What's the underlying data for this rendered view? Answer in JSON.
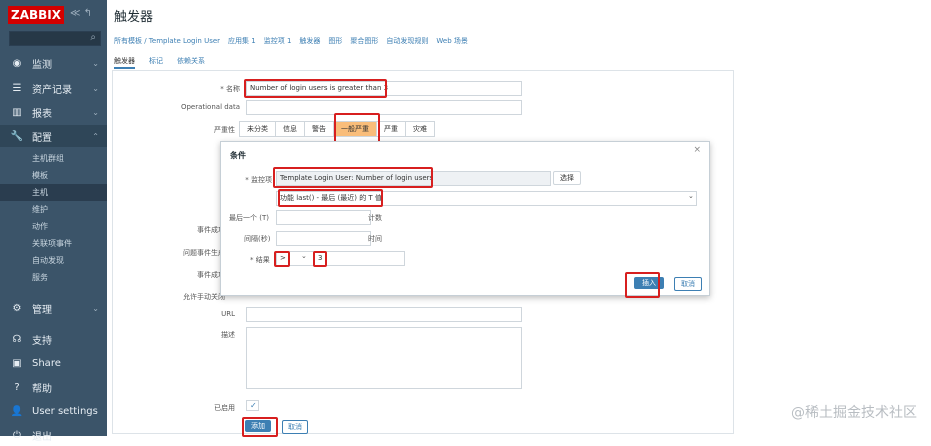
{
  "sidebar": {
    "logo": "ZABBIX",
    "top_icons": "≪ ↰",
    "menu": [
      {
        "icon": "eye-icon",
        "label": "监测"
      },
      {
        "icon": "list-icon",
        "label": "资产记录"
      },
      {
        "icon": "chart-icon",
        "label": "报表"
      },
      {
        "icon": "wrench-icon",
        "label": "配置"
      },
      {
        "icon": "gear-icon",
        "label": "管理"
      }
    ],
    "config_sub": [
      "主机群组",
      "模板",
      "主机",
      "维护",
      "动作",
      "关联项事件",
      "自动发现",
      "服务"
    ],
    "bottom": [
      {
        "icon": "support-icon",
        "label": "支持"
      },
      {
        "icon": "share-icon",
        "label": "Share"
      },
      {
        "icon": "help-icon",
        "label": "帮助"
      },
      {
        "icon": "user-icon",
        "label": "User settings"
      },
      {
        "icon": "logout-icon",
        "label": "退出"
      }
    ]
  },
  "page": {
    "title": "触发器",
    "breadcrumbs": [
      "所有模板 / Template Login User",
      "应用集 1",
      "监控项 1",
      "触发器",
      "图形",
      "聚合图形",
      "自动发现规则",
      "Web 场景"
    ],
    "subtabs": [
      "触发器",
      "标记",
      "依赖关系"
    ]
  },
  "form": {
    "name_label": "* 名称",
    "name_value": "Number of login users is greater than 3",
    "opdata_label": "Operational data",
    "severity_label": "严重性",
    "severities": [
      "未分类",
      "信息",
      "警告",
      "一般严重",
      "严重",
      "灾难"
    ],
    "labels_left": [
      "事件成功",
      "问题事件生成",
      "事件成功",
      "允许手动关闭"
    ],
    "url_label": "URL",
    "desc_label": "描述",
    "enabled_label": "已启用",
    "enabled_check": "✓",
    "add_button": "添加",
    "cancel_button": "取消"
  },
  "dialog": {
    "title": "条件",
    "close": "×",
    "item_label": "* 监控项",
    "item_value": "Template Login User: Number of login users",
    "select_button": "选择",
    "function_value": "功能   last() - 最后 (最近) 的 T 值",
    "last_of_label": "最后一个 (T)",
    "last_of_unit": "计数",
    "interval_label": "间隔(秒)",
    "interval_unit": "时间",
    "result_label": "* 结果",
    "result_op": ">",
    "result_value": "3",
    "insert_button": "插入",
    "cancel_button": "取消"
  },
  "watermark": "@稀土掘金技术社区"
}
